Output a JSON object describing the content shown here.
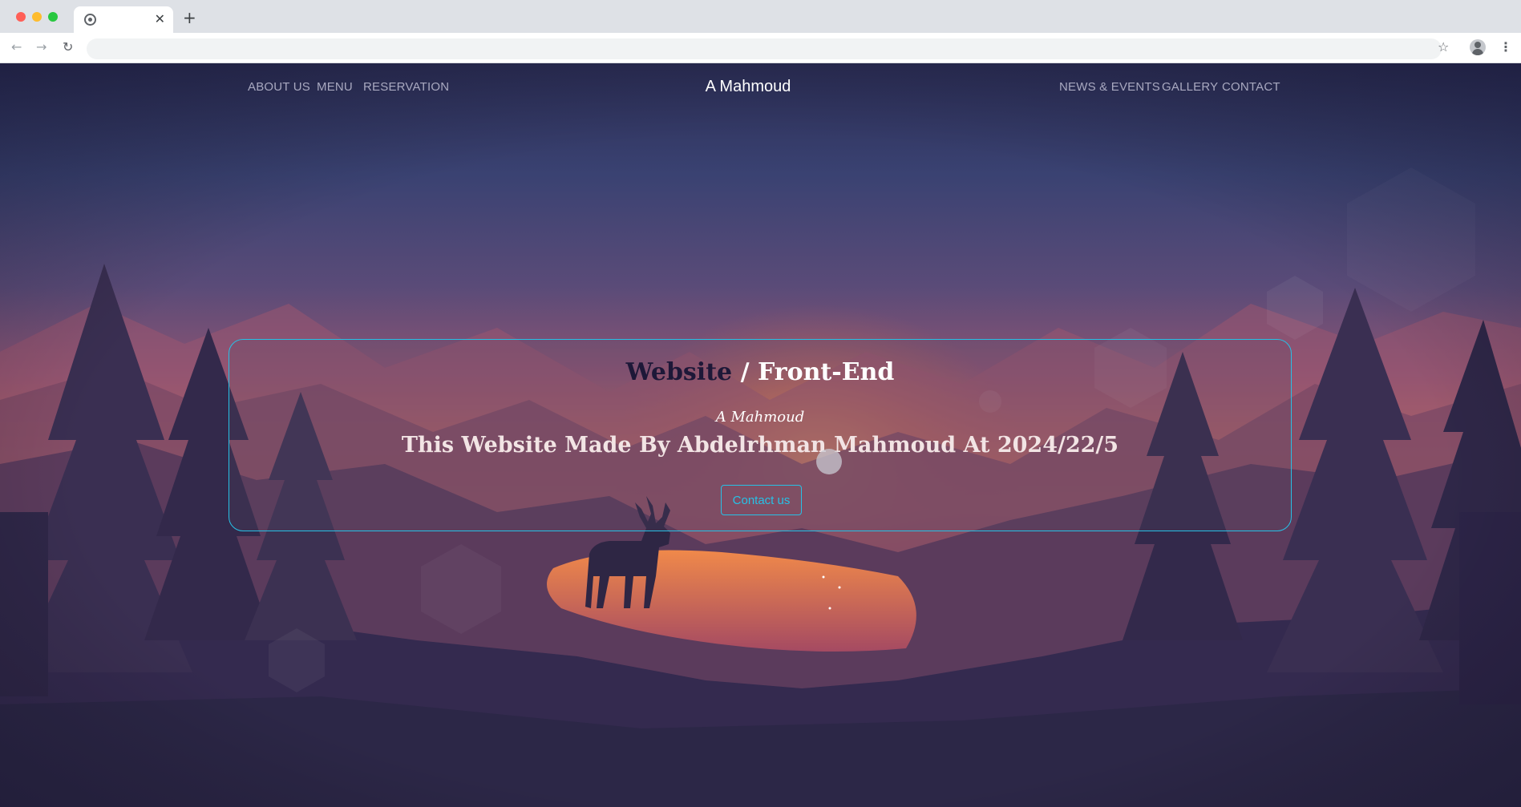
{
  "browser": {
    "tab_close": "✕",
    "new_tab": "+",
    "back": "←",
    "forward": "→",
    "reload": "↻",
    "address_value": "",
    "star": "☆",
    "menu": "⋮"
  },
  "site": {
    "brand": "A Mahmoud",
    "nav_left": [
      "ABOUT US",
      "MENU",
      "RESERVATION"
    ],
    "nav_right": [
      "NEWS & EVENTS",
      "GALLERY",
      "CONTACT"
    ]
  },
  "hero": {
    "title_accent": "Website",
    "title_separator": " / ",
    "title_rest": "Front-End",
    "signature": "A Mahmoud",
    "subtitle": "This Website Made By Abdelrhman Mahmoud At 2024/22/5",
    "button_label": "Contact us"
  },
  "colors": {
    "accent": "#27c1e6",
    "title_dark": "#1d1838",
    "nav_text": "#a9a9c0",
    "sky_top": "#2b2d55",
    "sunset": "#e77f4c",
    "ground": "#2c2747"
  }
}
